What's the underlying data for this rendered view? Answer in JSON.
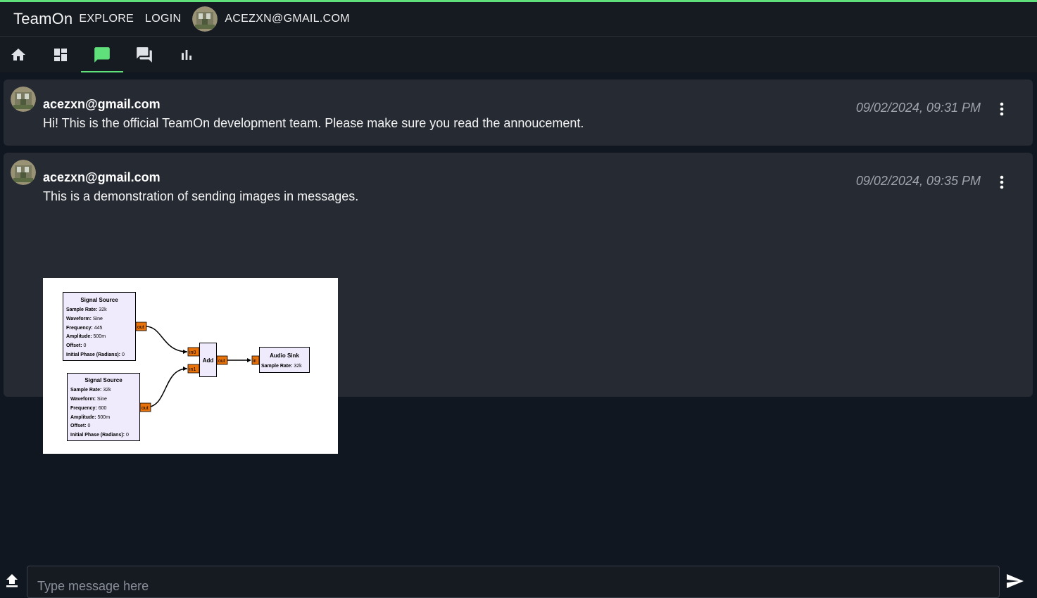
{
  "header": {
    "brand": "TeamOn",
    "explore_label": "EXPLORE",
    "login_label": "LOGIN",
    "user_email": "ACEZXN@GMAIL.COM"
  },
  "tabs": [
    {
      "icon": "home-icon"
    },
    {
      "icon": "dashboard-icon"
    },
    {
      "icon": "chat-icon",
      "active": true
    },
    {
      "icon": "forum-icon"
    },
    {
      "icon": "bar-chart-icon"
    }
  ],
  "messages": [
    {
      "author": "acezxn@gmail.com",
      "text": "Hi! This is the official TeamOn development team. Please make sure you read the annoucement.",
      "time": "09/02/2024, 09:31 PM"
    },
    {
      "author": "acezxn@gmail.com",
      "text": "This is a demonstration of sending images in messages.",
      "time": "09/02/2024, 09:35 PM",
      "image": {
        "blocks": {
          "source1": {
            "title": "Signal Source",
            "sample_rate": "32k",
            "waveform": "Sine",
            "frequency": "445",
            "amplitude": "500m",
            "offset": "0",
            "phase": "0"
          },
          "source2": {
            "title": "Signal Source",
            "sample_rate": "32k",
            "waveform": "Sine",
            "frequency": "600",
            "amplitude": "500m",
            "offset": "0",
            "phase": "0"
          },
          "add": {
            "title": "Add"
          },
          "sink": {
            "title": "Audio Sink",
            "sample_rate": "32k"
          }
        },
        "labels": {
          "sample_rate": "Sample Rate:",
          "waveform": "Waveform:",
          "frequency": "Frequency:",
          "amplitude": "Amplitude:",
          "offset": "Offset:",
          "phase": "Initial Phase (Radians):",
          "out": "out",
          "in0": "in0",
          "in1": "in1",
          "in": "in"
        }
      }
    }
  ],
  "composer": {
    "placeholder": "Type message here"
  },
  "colors": {
    "accent": "#5fe07a",
    "background": "#111720",
    "card": "#262a33",
    "port": "#e8730a",
    "block_fill": "#efeafc"
  }
}
